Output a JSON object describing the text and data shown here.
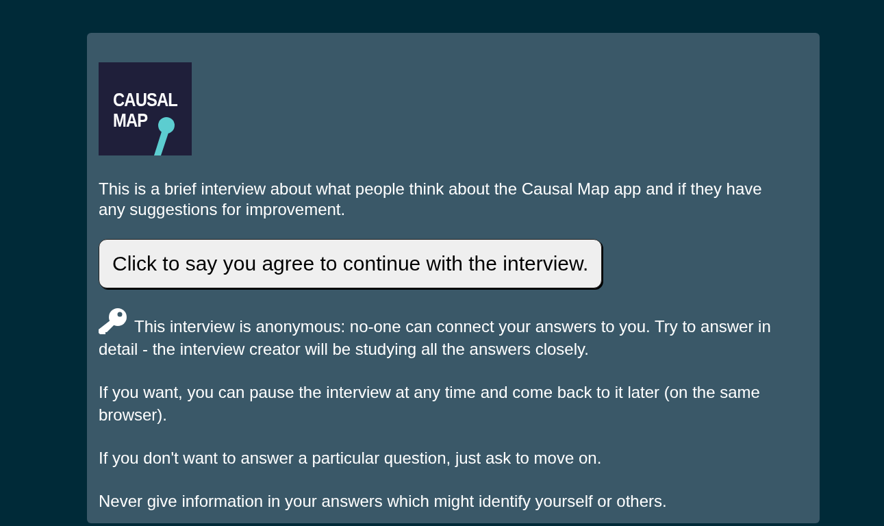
{
  "logo": {
    "lines": [
      "CAUSAL",
      "MAP"
    ]
  },
  "intro": "This is a brief interview about what people think about the Causal Map app and if they have any suggestions for improvement.",
  "agree_button": "Click to say you agree to continue with the interview.",
  "notes": [
    "This interview is anonymous: no-one can connect your answers to you. Try to answer in detail - the interview creator will be studying all the answers closely.",
    "If you want, you can pause the interview at any time and come back to it later (on the same browser).",
    "If you don't want to answer a particular question, just ask to move on.",
    "Never give information in your answers which might identify yourself or others."
  ]
}
